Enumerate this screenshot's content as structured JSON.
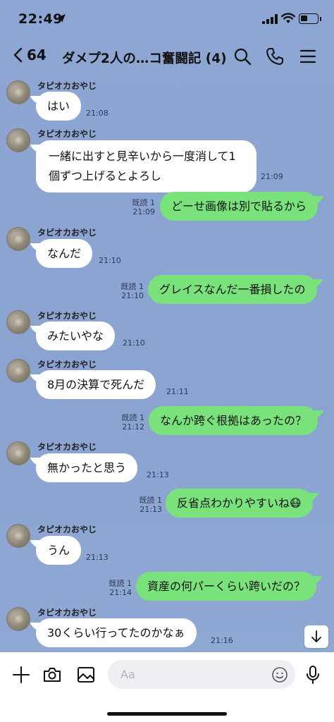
{
  "status_bar": {
    "time": "22:49"
  },
  "header": {
    "unread_count": "64",
    "title": "ダメプ2人の…コ奮闘記 (4)"
  },
  "messages": [
    {
      "sender": "タピオカおやじ",
      "text": "はい",
      "time": "21:08"
    },
    {
      "sender": "タピオカおやじ",
      "text": "一緒に出すと見辛いから一度消して1個ずつ上げるとよろし",
      "time": "21:09"
    },
    {
      "read": "既読 1",
      "text": "どーせ画像は別で貼るから",
      "time": "21:09"
    },
    {
      "sender": "タピオカおやじ",
      "text": "なんだ",
      "time": "21:10"
    },
    {
      "read": "既読 1",
      "text": "グレイスなんだ一番損したの",
      "time": "21:10"
    },
    {
      "sender": "タピオカおやじ",
      "text": "みたいやな",
      "time": "21:10"
    },
    {
      "sender": "タピオカおやじ",
      "text": "8月の決算で死んだ",
      "time": "21:11"
    },
    {
      "read": "既読 1",
      "text": "なんか跨ぐ根拠はあったの？",
      "time": "21:12"
    },
    {
      "sender": "タピオカおやじ",
      "text": "無かったと思う",
      "time": "21:13"
    },
    {
      "read": "既読 1",
      "text": "反省点わかりやすいね😷",
      "time": "21:13"
    },
    {
      "sender": "タピオカおやじ",
      "text": "うん",
      "time": "21:13"
    },
    {
      "read": "既読 1",
      "text": "資産の何パーくらい跨いだの？",
      "time": "21:14"
    },
    {
      "sender": "タピオカおやじ",
      "text": "30くらい行ってたのかなぁ",
      "time": "21:16"
    }
  ],
  "input": {
    "placeholder": "Aa"
  },
  "icons": {
    "back": "chevron-left-icon",
    "search": "search-icon",
    "call": "phone-icon",
    "menu": "menu-icon",
    "add": "plus-icon",
    "camera": "camera-icon",
    "image": "image-icon",
    "emoji": "smiley-icon",
    "mic": "microphone-icon",
    "scroll": "arrow-down-icon"
  },
  "colors": {
    "chat_background": "#8ba4d1",
    "outgoing_bubble": "#79e27a",
    "incoming_bubble": "#ffffff"
  }
}
